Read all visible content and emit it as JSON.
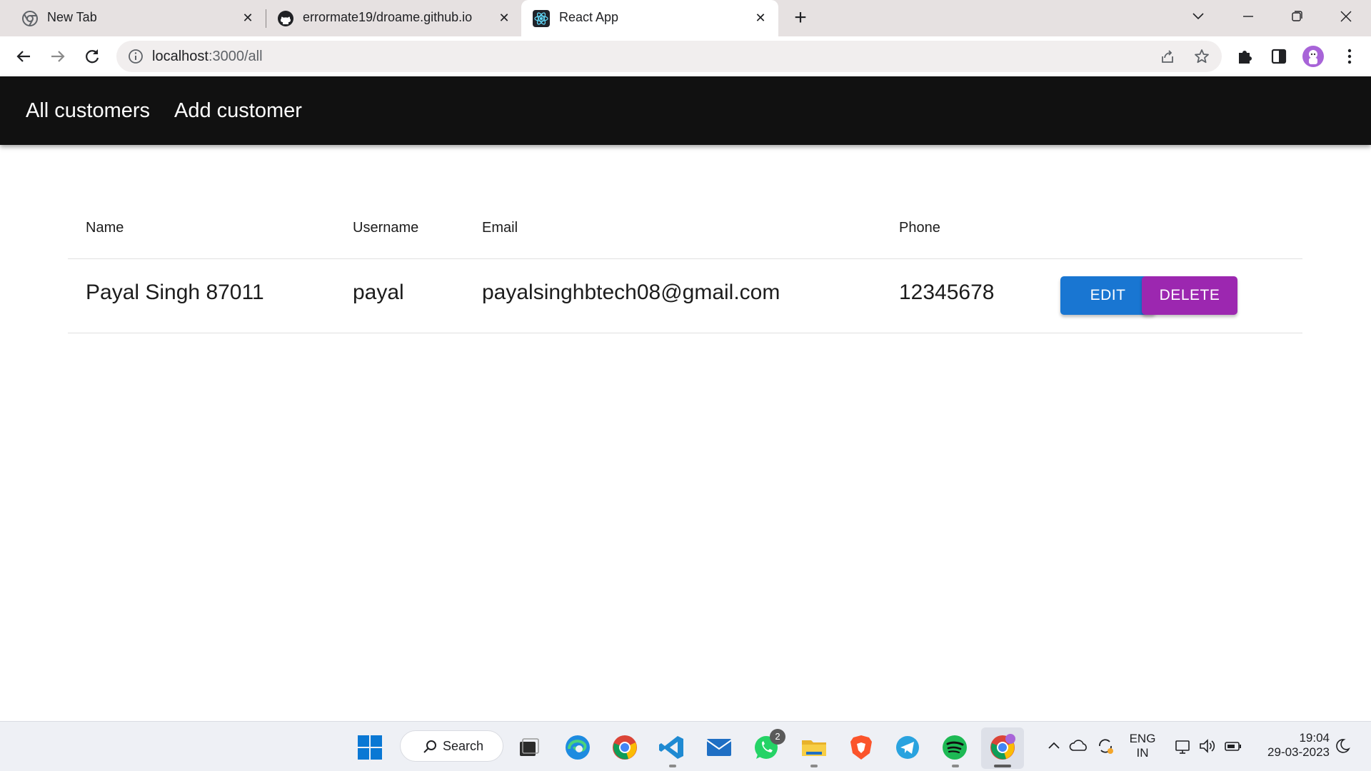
{
  "browser": {
    "tabs": [
      {
        "title": "New Tab",
        "icon": "chrome-icon"
      },
      {
        "title": "errormate19/droame.github.io",
        "icon": "github-icon"
      },
      {
        "title": "React App",
        "icon": "react-icon"
      }
    ],
    "active_tab": 2,
    "url_host": "localhost",
    "url_path": ":3000/all"
  },
  "app": {
    "nav": {
      "all_customers": "All customers",
      "add_customer": "Add customer"
    },
    "table": {
      "headers": {
        "name": "Name",
        "username": "Username",
        "email": "Email",
        "phone": "Phone"
      },
      "rows": [
        {
          "name": "Payal Singh 87011",
          "username": "payal",
          "email": "payalsinghbtech08@gmail.com",
          "phone": "12345678"
        }
      ],
      "edit_label": "EDIT",
      "delete_label": "DELETE"
    },
    "colors": {
      "edit": "#1976d2",
      "delete": "#9c27b0",
      "appbar": "#111111"
    }
  },
  "taskbar": {
    "search_label": "Search",
    "whatsapp_badge": "2",
    "lang_line1": "ENG",
    "lang_line2": "IN",
    "time": "19:04",
    "date": "29-03-2023"
  }
}
